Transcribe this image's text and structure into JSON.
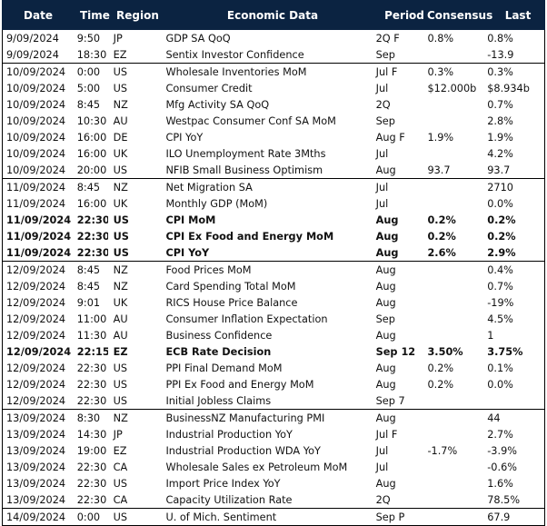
{
  "columns": {
    "date": "Date",
    "time": "Time",
    "region": "Region",
    "event": "Economic Data",
    "period": "Period",
    "consensus": "Consensus",
    "last": "Last"
  },
  "colors": {
    "header_bg": "#0b2341",
    "header_text": "#ffffff",
    "border": "#000000"
  },
  "groups": [
    {
      "day": "9/09/2024",
      "rows": [
        {
          "date": "9/09/2024",
          "time": "9:50",
          "region": "JP",
          "event": "GDP SA QoQ",
          "period": "2Q F",
          "consensus": "0.8%",
          "last": "0.8%",
          "bold": false
        },
        {
          "date": "9/09/2024",
          "time": "18:30",
          "region": "EZ",
          "event": "Sentix Investor Confidence",
          "period": "Sep",
          "consensus": "",
          "last": "-13.9",
          "bold": false
        }
      ]
    },
    {
      "day": "10/09/2024",
      "rows": [
        {
          "date": "10/09/2024",
          "time": "0:00",
          "region": "US",
          "event": "Wholesale Inventories MoM",
          "period": "Jul F",
          "consensus": "0.3%",
          "last": "0.3%",
          "bold": false
        },
        {
          "date": "10/09/2024",
          "time": "5:00",
          "region": "US",
          "event": "Consumer Credit",
          "period": "Jul",
          "consensus": "$12.000b",
          "last": "$8.934b",
          "bold": false
        },
        {
          "date": "10/09/2024",
          "time": "8:45",
          "region": "NZ",
          "event": "Mfg Activity SA QoQ",
          "period": "2Q",
          "consensus": "",
          "last": "0.7%",
          "bold": false
        },
        {
          "date": "10/09/2024",
          "time": "10:30",
          "region": "AU",
          "event": "Westpac Consumer Conf SA MoM",
          "period": "Sep",
          "consensus": "",
          "last": "2.8%",
          "bold": false
        },
        {
          "date": "10/09/2024",
          "time": "16:00",
          "region": "DE",
          "event": "CPI YoY",
          "period": "Aug F",
          "consensus": "1.9%",
          "last": "1.9%",
          "bold": false
        },
        {
          "date": "10/09/2024",
          "time": "16:00",
          "region": "UK",
          "event": "ILO Unemployment Rate 3Mths",
          "period": "Jul",
          "consensus": "",
          "last": "4.2%",
          "bold": false
        },
        {
          "date": "10/09/2024",
          "time": "20:00",
          "region": "US",
          "event": "NFIB Small Business Optimism",
          "period": "Aug",
          "consensus": "93.7",
          "last": "93.7",
          "bold": false
        }
      ]
    },
    {
      "day": "11/09/2024",
      "rows": [
        {
          "date": "11/09/2024",
          "time": "8:45",
          "region": "NZ",
          "event": "Net Migration SA",
          "period": "Jul",
          "consensus": "",
          "last": "2710",
          "bold": false
        },
        {
          "date": "11/09/2024",
          "time": "16:00",
          "region": "UK",
          "event": "Monthly GDP (MoM)",
          "period": "Jul",
          "consensus": "",
          "last": "0.0%",
          "bold": false
        },
        {
          "date": "11/09/2024",
          "time": "22:30",
          "region": "US",
          "event": "CPI MoM",
          "period": "Aug",
          "consensus": "0.2%",
          "last": "0.2%",
          "bold": true
        },
        {
          "date": "11/09/2024",
          "time": "22:30",
          "region": "US",
          "event": "CPI Ex Food and Energy MoM",
          "period": "Aug",
          "consensus": "0.2%",
          "last": "0.2%",
          "bold": true
        },
        {
          "date": "11/09/2024",
          "time": "22:30",
          "region": "US",
          "event": "CPI YoY",
          "period": "Aug",
          "consensus": "2.6%",
          "last": "2.9%",
          "bold": true
        }
      ]
    },
    {
      "day": "12/09/2024",
      "rows": [
        {
          "date": "12/09/2024",
          "time": "8:45",
          "region": "NZ",
          "event": "Food Prices MoM",
          "period": "Aug",
          "consensus": "",
          "last": "0.4%",
          "bold": false
        },
        {
          "date": "12/09/2024",
          "time": "8:45",
          "region": "NZ",
          "event": "Card Spending Total MoM",
          "period": "Aug",
          "consensus": "",
          "last": "0.7%",
          "bold": false
        },
        {
          "date": "12/09/2024",
          "time": "9:01",
          "region": "UK",
          "event": "RICS House Price Balance",
          "period": "Aug",
          "consensus": "",
          "last": "-19%",
          "bold": false
        },
        {
          "date": "12/09/2024",
          "time": "11:00",
          "region": "AU",
          "event": "Consumer Inflation Expectation",
          "period": "Sep",
          "consensus": "",
          "last": "4.5%",
          "bold": false
        },
        {
          "date": "12/09/2024",
          "time": "11:30",
          "region": "AU",
          "event": "Business Confidence",
          "period": "Aug",
          "consensus": "",
          "last": "1",
          "bold": false
        },
        {
          "date": "12/09/2024",
          "time": "22:15",
          "region": "EZ",
          "event": "ECB Rate Decision",
          "period": "Sep 12",
          "consensus": "3.50%",
          "last": "3.75%",
          "bold": true
        },
        {
          "date": "12/09/2024",
          "time": "22:30",
          "region": "US",
          "event": "PPI Final Demand MoM",
          "period": "Aug",
          "consensus": "0.2%",
          "last": "0.1%",
          "bold": false
        },
        {
          "date": "12/09/2024",
          "time": "22:30",
          "region": "US",
          "event": "PPI Ex Food and Energy MoM",
          "period": "Aug",
          "consensus": "0.2%",
          "last": "0.0%",
          "bold": false
        },
        {
          "date": "12/09/2024",
          "time": "22:30",
          "region": "US",
          "event": "Initial Jobless Claims",
          "period": "Sep 7",
          "consensus": "",
          "last": "",
          "bold": false
        }
      ]
    },
    {
      "day": "13/09/2024",
      "rows": [
        {
          "date": "13/09/2024",
          "time": "8:30",
          "region": "NZ",
          "event": "BusinessNZ Manufacturing PMI",
          "period": "Aug",
          "consensus": "",
          "last": "44",
          "bold": false
        },
        {
          "date": "13/09/2024",
          "time": "14:30",
          "region": "JP",
          "event": "Industrial Production YoY",
          "period": "Jul F",
          "consensus": "",
          "last": "2.7%",
          "bold": false
        },
        {
          "date": "13/09/2024",
          "time": "19:00",
          "region": "EZ",
          "event": "Industrial Production WDA YoY",
          "period": "Jul",
          "consensus": "-1.7%",
          "last": "-3.9%",
          "bold": false
        },
        {
          "date": "13/09/2024",
          "time": "22:30",
          "region": "CA",
          "event": "Wholesale Sales ex Petroleum MoM",
          "period": "Jul",
          "consensus": "",
          "last": "-0.6%",
          "bold": false
        },
        {
          "date": "13/09/2024",
          "time": "22:30",
          "region": "US",
          "event": "Import Price Index YoY",
          "period": "Aug",
          "consensus": "",
          "last": "1.6%",
          "bold": false
        },
        {
          "date": "13/09/2024",
          "time": "22:30",
          "region": "CA",
          "event": "Capacity Utilization Rate",
          "period": "2Q",
          "consensus": "",
          "last": "78.5%",
          "bold": false
        }
      ]
    },
    {
      "day": "14/09/2024",
      "rows": [
        {
          "date": "14/09/2024",
          "time": "0:00",
          "region": "US",
          "event": "U. of Mich. Sentiment",
          "period": "Sep P",
          "consensus": "",
          "last": "67.9",
          "bold": false
        }
      ]
    }
  ]
}
